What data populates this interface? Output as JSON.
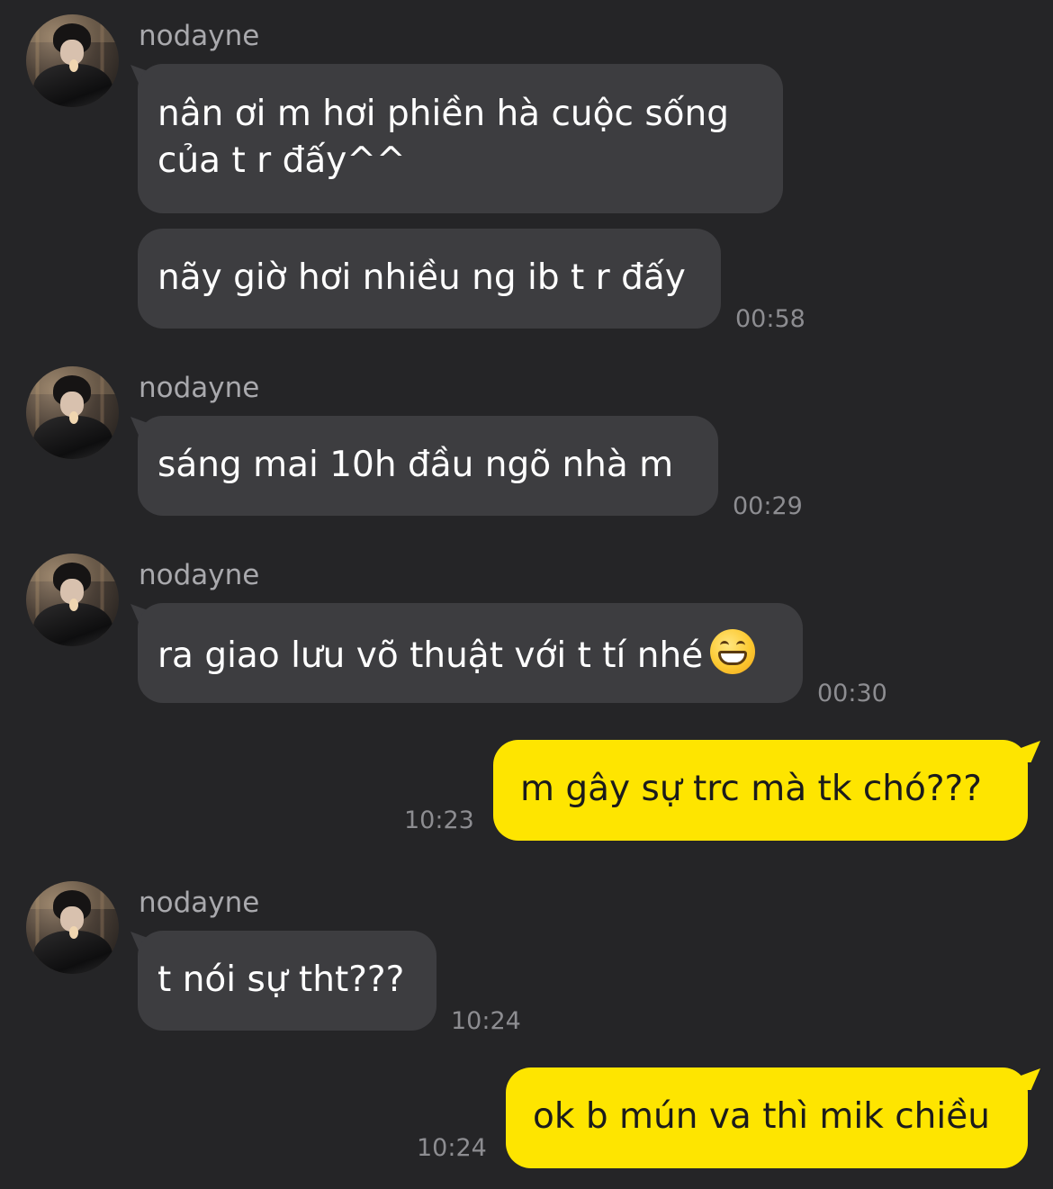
{
  "chat": {
    "groups": [
      {
        "sender": "nodayne",
        "avatar": "profile-photo",
        "messages": [
          {
            "text": "nân ơi m hơi phiền hà cuộc sống\ncủa t r đấy^^"
          },
          {
            "text": "nãy giờ hơi nhiều ng ib t r đấy",
            "time": "00:58"
          }
        ]
      },
      {
        "sender": "nodayne",
        "avatar": "profile-photo",
        "messages": [
          {
            "text": "sáng mai 10h đầu ngõ nhà m",
            "time": "00:29"
          }
        ]
      },
      {
        "sender": "nodayne",
        "avatar": "profile-photo",
        "messages": [
          {
            "text": "ra giao lưu võ thuật với t tí nhé",
            "emoji": "grinning-face-emoji",
            "time": "00:30"
          }
        ]
      },
      {
        "sender": "me",
        "messages": [
          {
            "text": "m gây sự trc mà tk chó???",
            "time": "10:23"
          }
        ]
      },
      {
        "sender": "nodayne",
        "avatar": "profile-photo",
        "messages": [
          {
            "text": "t nói sự tht???",
            "time": "10:24"
          }
        ]
      },
      {
        "sender": "me",
        "messages": [
          {
            "text": "ok b mún va thì mik chiều",
            "time": "10:24"
          }
        ]
      }
    ]
  },
  "colors": {
    "background": "#252527",
    "incoming_bubble": "#3d3d40",
    "outgoing_bubble": "#fee500",
    "timestamp": "#8d8d91",
    "sender_name": "#a9a9ad"
  }
}
